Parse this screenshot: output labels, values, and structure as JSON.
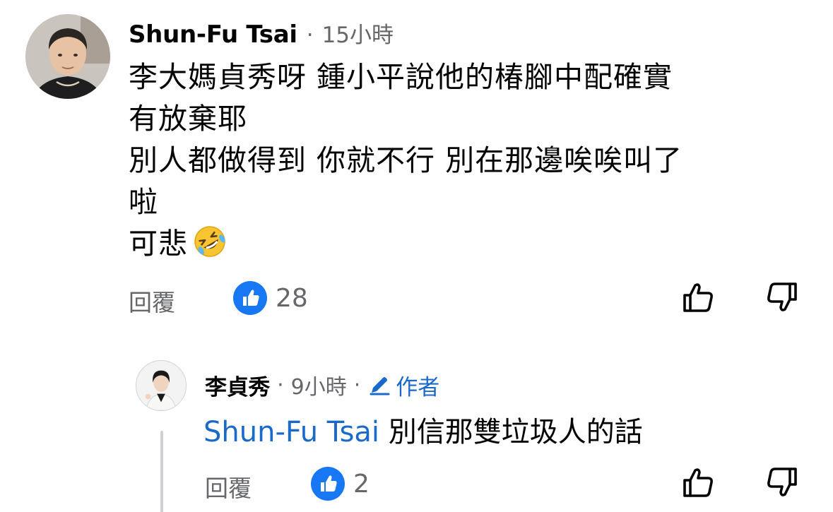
{
  "comment": {
    "author": "Shun-Fu Tsai",
    "separator": "·",
    "time": "15小時",
    "lines": [
      "李大媽貞秀呀 鍾小平說他的椿腳中配確實",
      "有放棄耶",
      "別人都做得到 你就不行 別在那邊唉唉叫了",
      "啦",
      "可悲"
    ],
    "emoji": "rolling-on-floor-laughing",
    "reply_label": "回覆",
    "like_count": "28"
  },
  "reply": {
    "author": "李貞秀",
    "separator": "·",
    "time": "9小時",
    "separator2": "·",
    "author_badge": "作者",
    "mention": "Shun-Fu Tsai",
    "text": " 別信那雙垃圾人的話",
    "reply_label": "回覆",
    "like_count": "2"
  },
  "colors": {
    "like_blue": "#1877f2",
    "link_blue": "#1b6ac9",
    "secondary_text": "#65676b",
    "thread_line": "#ccd0d5"
  }
}
